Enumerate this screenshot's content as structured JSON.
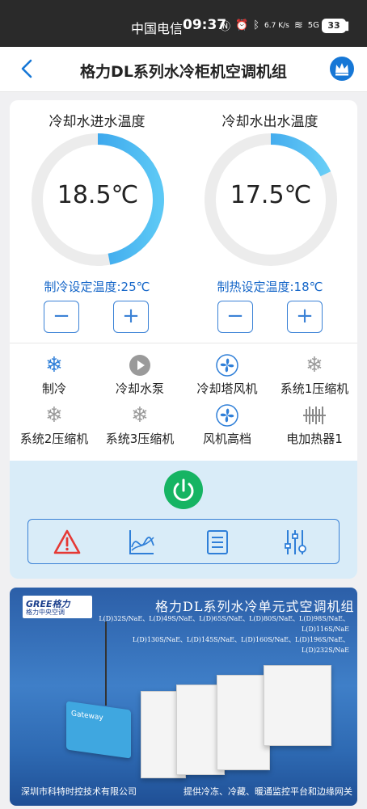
{
  "status_bar": {
    "carrier": "中国电信",
    "time": "09:37",
    "net_speed": "6.7 K/s",
    "signal": "5G",
    "battery": "33"
  },
  "header": {
    "title": "格力DL系列水冷柜机空调机组"
  },
  "gauges": {
    "inlet": {
      "label": "冷却水进水温度",
      "value": "18.5℃",
      "fill_fraction": 0.47
    },
    "outlet": {
      "label": "冷却水出水温度",
      "value": "17.5℃",
      "fill_fraction": 0.18
    }
  },
  "setpoints": {
    "cooling": {
      "label": "制冷设定温度:25℃",
      "minus": "−",
      "plus": "+"
    },
    "heating": {
      "label": "制热设定温度:18℃",
      "minus": "−",
      "plus": "+"
    }
  },
  "devices": [
    {
      "label": "制冷",
      "icon": "snowflake-icon",
      "active": true
    },
    {
      "label": "冷却水泵",
      "icon": "pump-play-icon",
      "active": false
    },
    {
      "label": "冷却塔风机",
      "icon": "fan-icon",
      "active": true
    },
    {
      "label": "系统1压缩机",
      "icon": "snowflake-icon",
      "active": false
    },
    {
      "label": "系统2压缩机",
      "icon": "snowflake-icon",
      "active": false
    },
    {
      "label": "系统3压缩机",
      "icon": "snowflake-icon",
      "active": false
    },
    {
      "label": "风机高档",
      "icon": "fan-icon",
      "active": true
    },
    {
      "label": "电加热器1",
      "icon": "heater-icon",
      "active": false
    }
  ],
  "colors": {
    "accent": "#1677d6",
    "active_icon": "#2f7fd8",
    "inactive_icon": "#9a9a9a",
    "power": "#16b463",
    "alarm": "#e53935",
    "panel": "#d9ecf8"
  },
  "toolbar": {
    "items": [
      "alarm-icon",
      "trend-chart-icon",
      "list-icon",
      "settings-sliders-icon"
    ]
  },
  "banner": {
    "logo": "GREE格力",
    "logo_sub": "格力中央空调",
    "title": "格力DL系列水冷单元式空调机组",
    "models_line1": "L(D)32S/NaE、L(D)49S/NaE、L(D)65S/NaE、L(D)80S/NaE、L(D)98S/NaE、L(D)116S/NaE",
    "models_line2": "L(D)130S/NaE、L(D)145S/NaE、L(D)160S/NaE、L(D)196S/NaE、L(D)232S/NaE",
    "gateway_label": "Gateway",
    "footer_left": "深圳市科特时控技术有限公司",
    "footer_right": "提供冷冻、冷藏、暖通监控平台和边缘网关"
  }
}
